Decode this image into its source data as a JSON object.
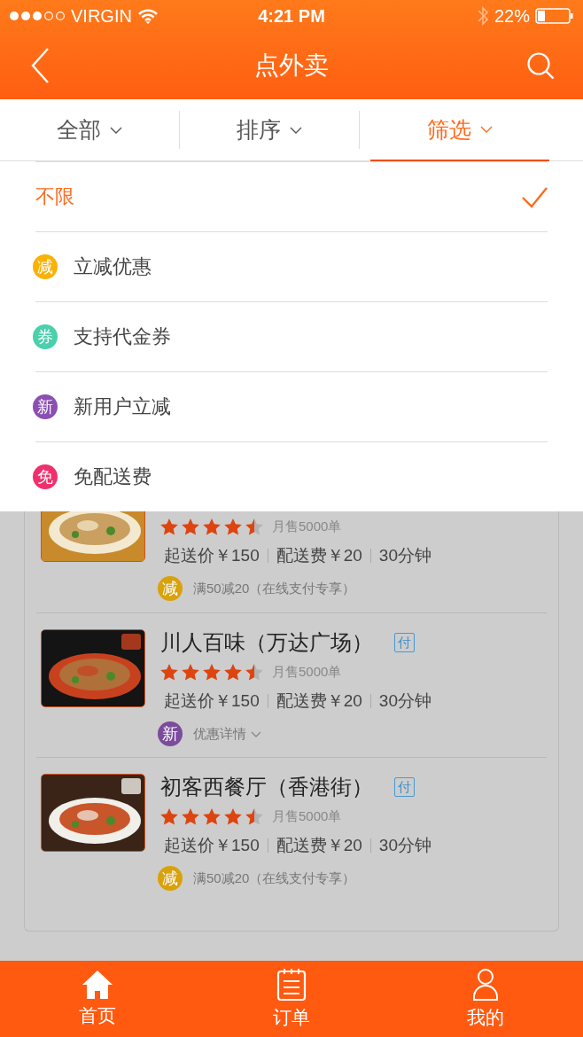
{
  "status_bar": {
    "carrier": "VIRGIN",
    "time": "4:21 PM",
    "battery": "22%"
  },
  "nav": {
    "title": "点外卖"
  },
  "filter_tabs": [
    {
      "label": "全部",
      "selected": false
    },
    {
      "label": "排序",
      "selected": false
    },
    {
      "label": "筛选",
      "selected": true
    }
  ],
  "filter_options": [
    {
      "label": "不限",
      "selected": true
    },
    {
      "label": "立减优惠",
      "selected": false,
      "badge": "减",
      "color": "#f9b208"
    },
    {
      "label": "支持代金券",
      "selected": false,
      "badge": "券",
      "color": "#4ad0ac"
    },
    {
      "label": "新用户立减",
      "selected": false,
      "badge": "新",
      "color": "#8b4fb3"
    },
    {
      "label": "免配送费",
      "selected": false,
      "badge": "免",
      "color": "#f0306c"
    }
  ],
  "restaurants": [
    {
      "stars": 4.5,
      "sales": "月售5000单",
      "min_order": "起送价￥150",
      "delivery_fee": "配送费￥20",
      "delivery_time": "30分钟",
      "promo": {
        "kind": "note",
        "badge": "减",
        "color": "#d9a20c",
        "text": "满50减20（在线支付专享）"
      }
    },
    {
      "name": "川人百味（万达广场）",
      "pay_badge": "付",
      "stars": 4.5,
      "sales": "月售5000单",
      "min_order": "起送价￥150",
      "delivery_fee": "配送费￥20",
      "delivery_time": "30分钟",
      "promo": {
        "kind": "details",
        "badge": "新",
        "color": "#7b4b9c",
        "text": "优惠详情"
      }
    },
    {
      "name": "初客西餐厅（香港街）",
      "pay_badge": "付",
      "stars": 4.5,
      "sales": "月售5000单",
      "min_order": "起送价￥150",
      "delivery_fee": "配送费￥20",
      "delivery_time": "30分钟",
      "promo": {
        "kind": "note",
        "badge": "减",
        "color": "#d9a20c",
        "text": "满50减20（在线支付专享）"
      }
    }
  ],
  "tab_bar": [
    {
      "label": "首页",
      "selected": true
    },
    {
      "label": "订单",
      "selected": false
    },
    {
      "label": "我的",
      "selected": false
    }
  ]
}
